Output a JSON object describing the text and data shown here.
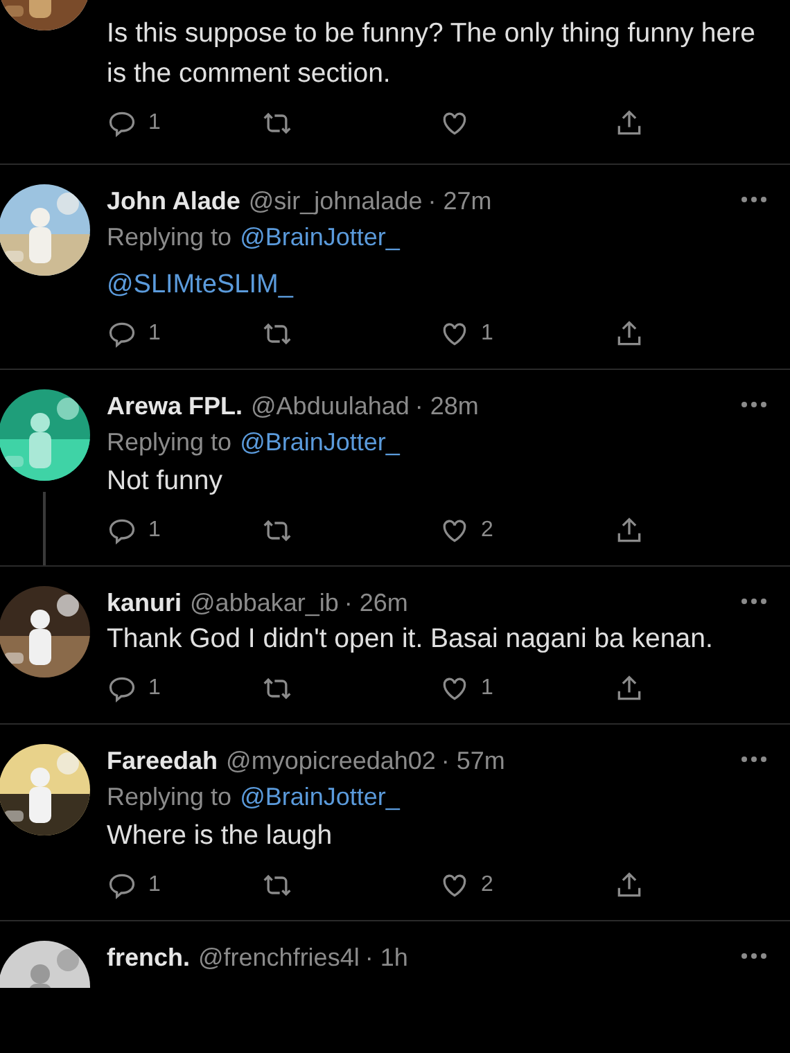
{
  "tweets": [
    {
      "kind": "partial",
      "body": "Is this suppose to be funny? The only thing funny here is the comment section.",
      "replies": "1"
    },
    {
      "kind": "full",
      "name": "John Alade",
      "handle": "@sir_johnalade",
      "time": "· 27m",
      "replying_label": "Replying to",
      "replying_to": "@BrainJotter_",
      "mention_body": "@SLIMteSLIM_",
      "replies": "1",
      "likes": "1"
    },
    {
      "kind": "full",
      "thread_line": true,
      "name": "Arewa FPL.",
      "handle": "@Abduulahad",
      "time": "· 28m",
      "replying_label": "Replying to",
      "replying_to": "@BrainJotter_",
      "body": "Not funny",
      "replies": "1",
      "likes": "2"
    },
    {
      "kind": "full",
      "thread_line": false,
      "name": "kanuri",
      "handle": "@abbakar_ib",
      "time": "· 26m",
      "body": "Thank God I didn't open it. Basai nagani ba kenan.",
      "replies": "1",
      "likes": "1"
    },
    {
      "kind": "full",
      "name": "Fareedah",
      "handle": "@myopicreedah02",
      "time": "· 57m",
      "replying_label": "Replying to",
      "replying_to": "@BrainJotter_",
      "body": "Where is the laugh",
      "replies": "1",
      "likes": "2"
    },
    {
      "kind": "header_only",
      "name": "french.",
      "handle": "@frenchfries4l",
      "time": "· 1h"
    }
  ]
}
